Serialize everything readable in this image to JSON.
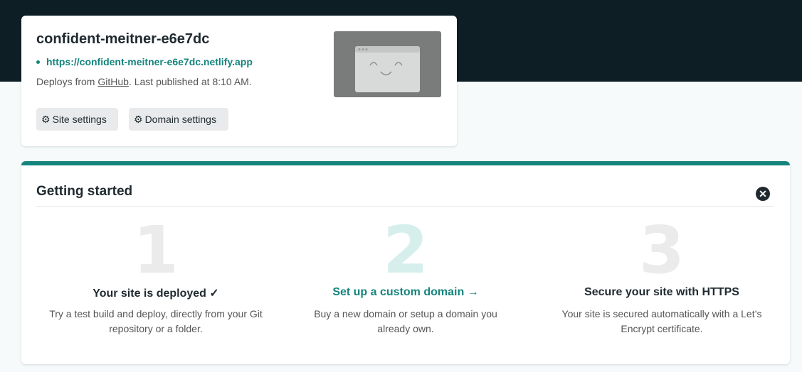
{
  "site": {
    "name": "confident-meitner-e6e7dc",
    "url": "https://confident-meitner-e6e7dc.netlify.app",
    "deploy_prefix": "Deploys from ",
    "deploy_provider": "GitHub",
    "deploy_suffix": ". Last published at 8:10 AM.",
    "site_settings_label": "Site settings",
    "domain_settings_label": "Domain settings"
  },
  "getting_started": {
    "title": "Getting started",
    "steps": [
      {
        "number": "1",
        "title": "Your site is deployed ✓",
        "description": "Try a test build and deploy, directly from your Git repository or a folder."
      },
      {
        "number": "2",
        "title": "Set up a custom domain →",
        "description": "Buy a new domain or setup a domain you already own."
      },
      {
        "number": "3",
        "title": "Secure your site with HTTPS",
        "description": "Your site is secured automatically with a Let’s Encrypt certificate."
      }
    ]
  },
  "colors": {
    "accent": "#15847d",
    "header_bg": "#0e1e25",
    "page_bg": "#f6fafa"
  },
  "icons": {
    "settings": "gear-icon",
    "close": "close-icon",
    "preview": "smiley-browser-icon"
  }
}
